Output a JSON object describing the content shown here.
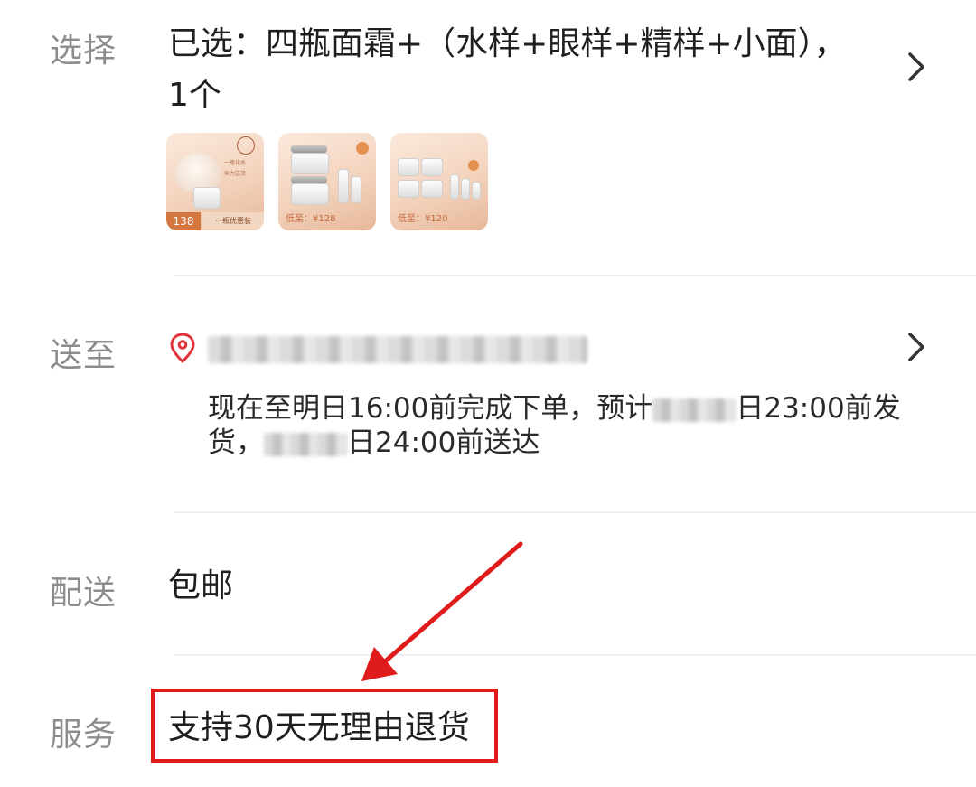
{
  "select": {
    "label": "选择",
    "value_line1": "已选：四瓶面霜+（水样+眼样+精样+小面），",
    "value_line2": "1个",
    "thumbnails": [
      {
        "price": "138",
        "text": "一瓶优惠装",
        "mark1": "一瓶化水",
        "mark2": "实力送货"
      },
      {
        "price": "低至：¥128"
      },
      {
        "price": "低至：¥120"
      }
    ]
  },
  "ship_to": {
    "label": "送至",
    "delivery_p1": "现在至明日16:00前完成下单，预计",
    "delivery_p2": "日23:00前发货，",
    "delivery_p3": "日24:00前送达"
  },
  "shipping": {
    "label": "配送",
    "value": "包邮"
  },
  "service": {
    "label": "服务",
    "value": "支持30天无理由退货"
  },
  "colors": {
    "annotation": "#e01b1b",
    "location_icon": "#e0343a"
  },
  "icons": [
    "chevron-right-icon",
    "location-pin-icon",
    "arrow-annotation"
  ]
}
